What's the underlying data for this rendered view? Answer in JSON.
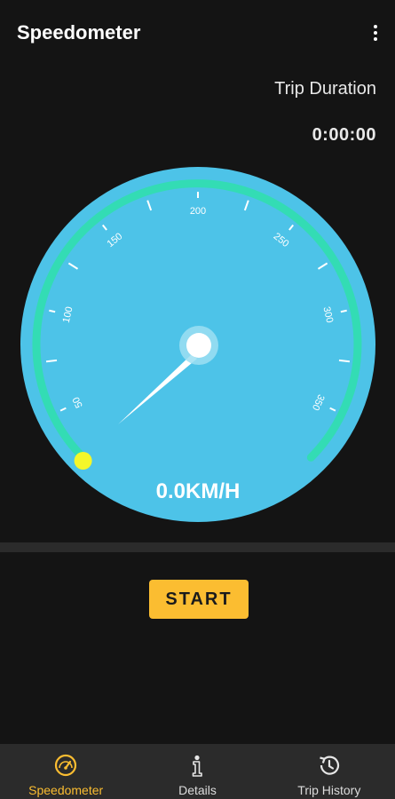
{
  "app_bar": {
    "title": "Speedometer"
  },
  "trip": {
    "label": "Trip Duration",
    "value": "0:00:00"
  },
  "gauge": {
    "tick_labels": [
      "50",
      "100",
      "150",
      "200",
      "250",
      "300",
      "350"
    ],
    "speed_readout": "0.0KM/H",
    "dial_color": "#4dc3e8",
    "track_color": "#33dcb4",
    "marker_color": "#f4f72a"
  },
  "actions": {
    "start_label": "START"
  },
  "bottom_nav": {
    "items": [
      {
        "label": "Speedometer",
        "icon": "speedometer-icon",
        "active": true
      },
      {
        "label": "Details",
        "icon": "info-icon",
        "active": false
      },
      {
        "label": "Trip History",
        "icon": "history-icon",
        "active": false
      }
    ]
  },
  "colors": {
    "background": "#141414",
    "accent": "#fbbd31",
    "nav_background": "#2b2b2b"
  }
}
